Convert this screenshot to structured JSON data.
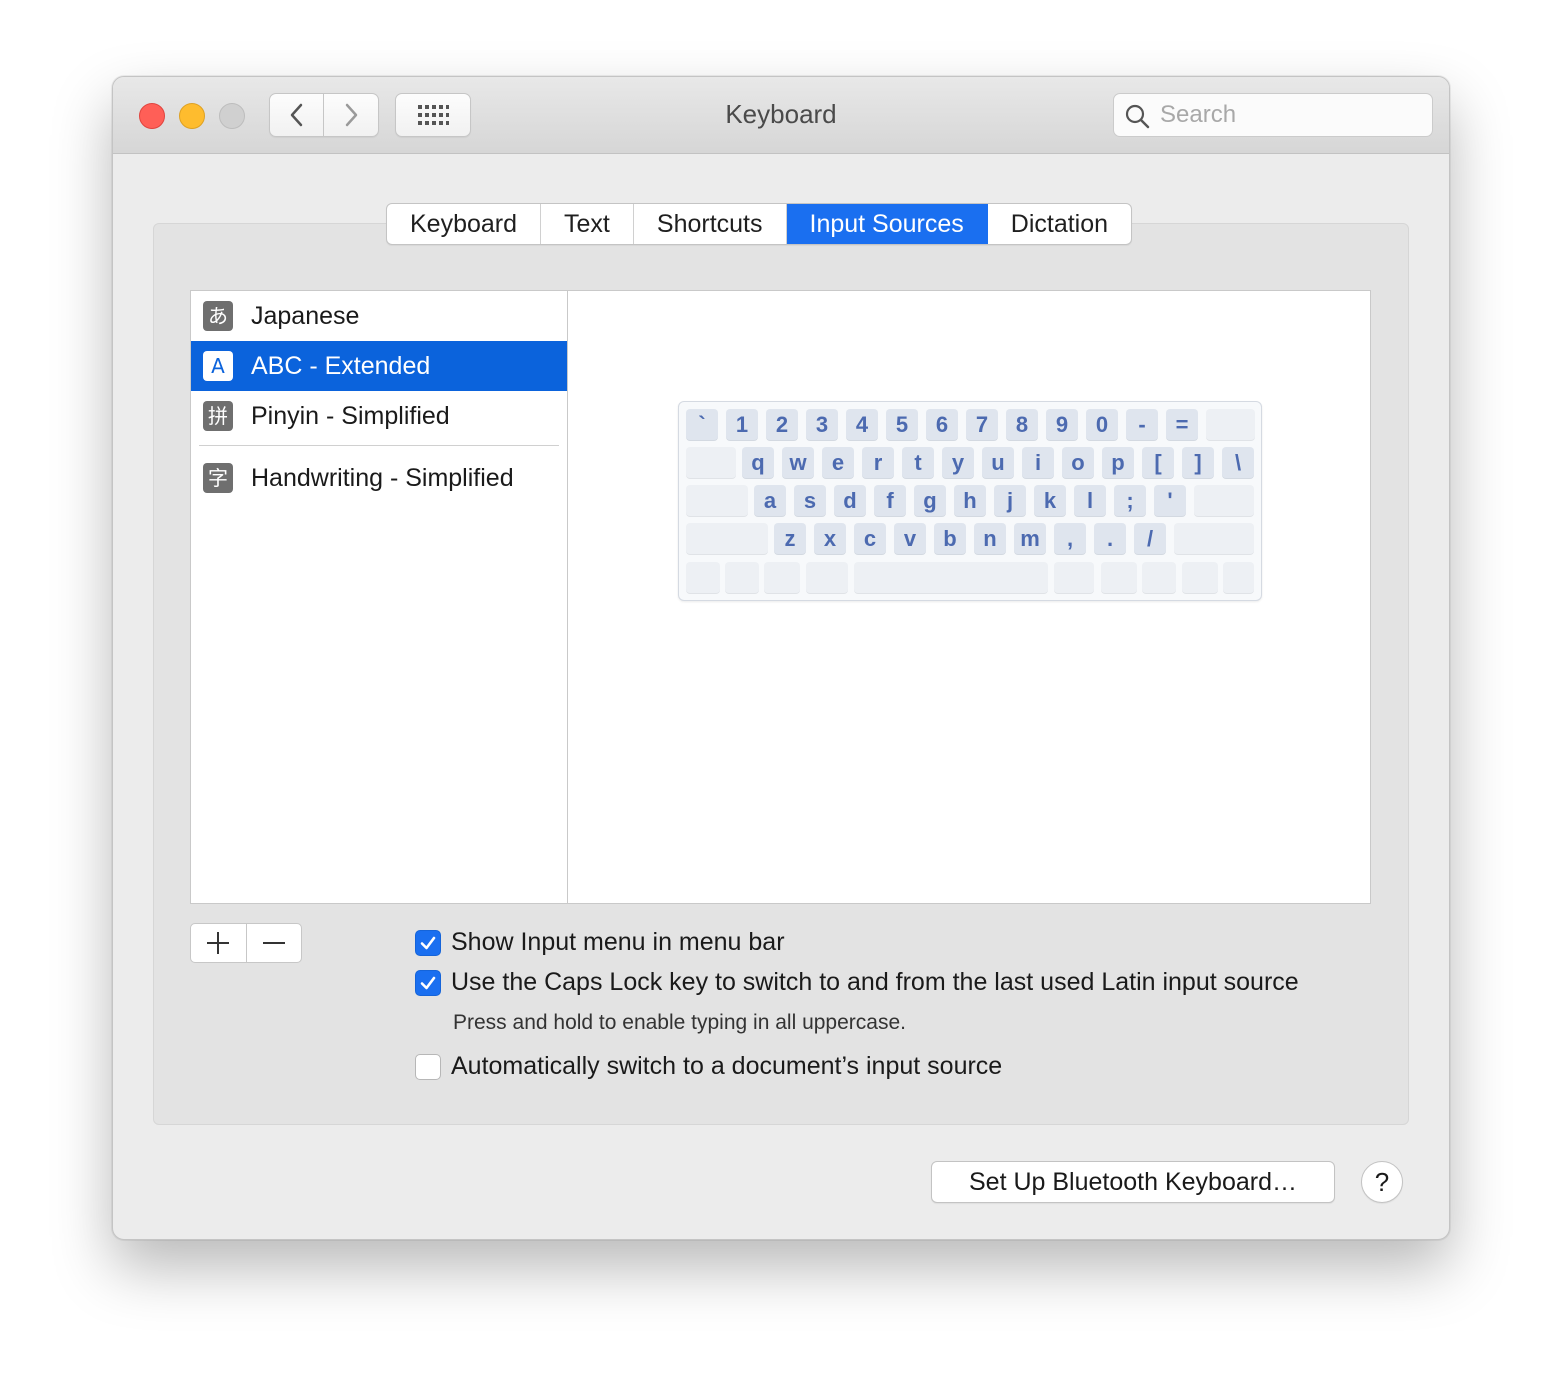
{
  "window": {
    "title": "Keyboard"
  },
  "search": {
    "placeholder": "Search"
  },
  "tabs": [
    {
      "label": "Keyboard"
    },
    {
      "label": "Text"
    },
    {
      "label": "Shortcuts"
    },
    {
      "label": "Input Sources",
      "active": true
    },
    {
      "label": "Dictation"
    }
  ],
  "sources": [
    {
      "icon": "あ",
      "label": "Japanese"
    },
    {
      "icon": "A",
      "label": "ABC - Extended",
      "selected": true
    },
    {
      "icon": "拼",
      "label": "Pinyin - Simplified"
    },
    {
      "icon": "字",
      "label": "Handwriting - Simplified"
    }
  ],
  "keyboard_preview": {
    "row1": [
      "`",
      "1",
      "2",
      "3",
      "4",
      "5",
      "6",
      "7",
      "8",
      "9",
      "0",
      "-",
      "="
    ],
    "row2": [
      "q",
      "w",
      "e",
      "r",
      "t",
      "y",
      "u",
      "i",
      "o",
      "p",
      "[",
      "]",
      "\\"
    ],
    "row3": [
      "a",
      "s",
      "d",
      "f",
      "g",
      "h",
      "j",
      "k",
      "l",
      ";",
      "'"
    ],
    "row4": [
      "z",
      "x",
      "c",
      "v",
      "b",
      "n",
      "m",
      ",",
      ".",
      "/"
    ]
  },
  "list_buttons": {
    "add": "+",
    "remove": "—"
  },
  "options": {
    "show_input_menu": {
      "label": "Show Input menu in menu bar",
      "checked": true
    },
    "caps_lock": {
      "label": "Use the Caps Lock key to switch to and from the last used Latin input source",
      "checked": true
    },
    "caps_lock_note": "Press and hold to enable typing in all uppercase.",
    "auto_switch": {
      "label": "Automatically switch to a document’s input source",
      "checked": false
    }
  },
  "footer": {
    "bluetooth_button": "Set Up Bluetooth Keyboard…",
    "help_button": "?"
  },
  "colors": {
    "accent": "#1a6ff0",
    "selection": "#0b63dc",
    "key_text": "#4c6ab0"
  }
}
